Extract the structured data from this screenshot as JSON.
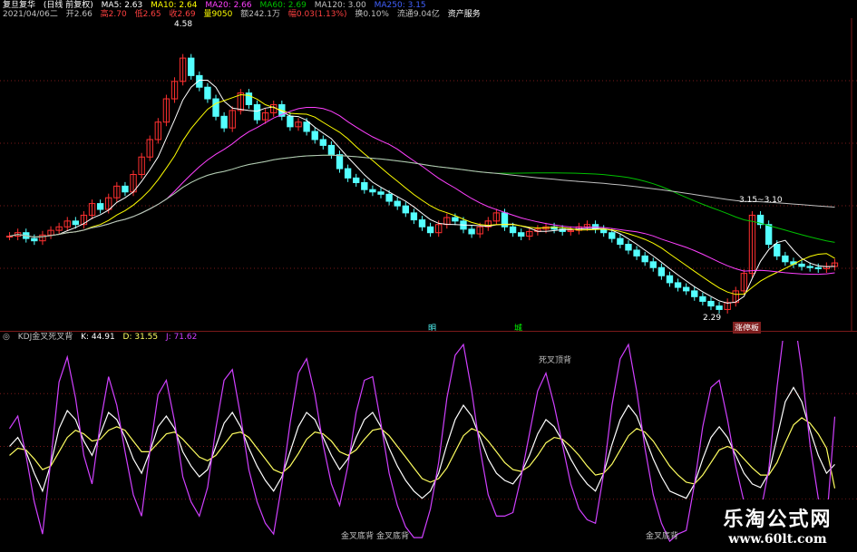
{
  "header": {
    "line1": {
      "stock": "复旦复华",
      "mode": "(日线 前复权)",
      "ma5": "MA5: 2.63",
      "ma10": "MA10: 2.64",
      "ma20": "MA20: 2.66",
      "ma60": "MA60: 2.69",
      "ma120": "MA120: 3.00",
      "ma250": "MA250: 3.15"
    },
    "line2": {
      "date": "2021/04/06二",
      "open": "开2.66",
      "high": "高2.70",
      "low": "低2.65",
      "close": "收2.69",
      "volume": "量9050",
      "amount": "额242.1万",
      "change": "幅0.03(1.13%)",
      "turnover": "换0.10%",
      "float": "流通9.04亿",
      "asset": "资产服务"
    }
  },
  "price_annotations": {
    "high_label": "4.58",
    "low_label": "2.29",
    "range_label": "3.15~3.10",
    "marker_a": "明",
    "marker_b": "城",
    "marker_c": "涨停板"
  },
  "kdj_header": {
    "title": "KDJ金叉死叉背",
    "k": "K: 44.91",
    "d": "D: 31.55",
    "j": "J: 71.62"
  },
  "kdj_annotations": {
    "death_divergence": "死叉顶背",
    "golden_div_1": "金叉底背",
    "golden_div_2": "金叉底背",
    "golden_div_3": "金叉底背"
  },
  "watermark": {
    "title": "乐淘公式网",
    "url": "www.60lt.com"
  },
  "colors": {
    "up": "#ff3030",
    "down": "#54ffff",
    "ma5": "#ffffff",
    "ma10": "#ffff00",
    "ma20": "#ff40ff",
    "ma60": "#00c000",
    "ma120": "#c0c0c0",
    "kdj_k": "#ffffff",
    "kdj_d": "#ffff60",
    "kdj_j": "#d040ff",
    "grid": "#7a1a1a"
  },
  "chart_data": [
    {
      "type": "candlestick",
      "title": "复旦复华 (日线 前复权)",
      "ylim": [
        2.2,
        4.7
      ],
      "high": 4.58,
      "low": 2.29,
      "close": [
        2.92,
        2.95,
        2.9,
        2.88,
        2.93,
        2.97,
        3.0,
        3.05,
        3.02,
        3.1,
        3.2,
        3.15,
        3.25,
        3.35,
        3.3,
        3.45,
        3.6,
        3.75,
        3.9,
        4.1,
        4.25,
        4.45,
        4.3,
        4.2,
        4.1,
        3.95,
        3.85,
        4.0,
        4.15,
        4.05,
        3.92,
        3.98,
        4.05,
        3.95,
        3.86,
        3.9,
        3.82,
        3.75,
        3.7,
        3.62,
        3.5,
        3.42,
        3.38,
        3.32,
        3.3,
        3.28,
        3.22,
        3.18,
        3.12,
        3.06,
        3.0,
        2.95,
        3.02,
        3.08,
        3.05,
        2.98,
        2.94,
        3.0,
        3.05,
        3.12,
        3.0,
        2.95,
        2.92,
        2.96,
        2.98,
        3.0,
        2.98,
        2.96,
        2.97,
        3.0,
        3.02,
        2.98,
        2.95,
        2.9,
        2.85,
        2.8,
        2.75,
        2.7,
        2.65,
        2.58,
        2.52,
        2.48,
        2.45,
        2.4,
        2.36,
        2.32,
        2.29,
        2.35,
        2.45,
        2.6,
        3.1,
        3.02,
        2.85,
        2.75,
        2.7,
        2.68,
        2.66,
        2.65,
        2.64,
        2.66,
        2.69
      ]
    },
    {
      "type": "line",
      "title": "KDJ金叉死叉背",
      "ylim": [
        0,
        110
      ],
      "series": [
        {
          "name": "K",
          "values": [
            55,
            60,
            52,
            40,
            30,
            45,
            65,
            75,
            70,
            58,
            50,
            62,
            74,
            70,
            60,
            48,
            40,
            52,
            66,
            72,
            65,
            52,
            44,
            38,
            42,
            55,
            68,
            74,
            66,
            54,
            44,
            36,
            30,
            38,
            52,
            66,
            74,
            70,
            60,
            50,
            42,
            48,
            60,
            70,
            74,
            66,
            54,
            44,
            36,
            30,
            26,
            30,
            40,
            56,
            70,
            78,
            72,
            60,
            48,
            40,
            36,
            34,
            40,
            50,
            62,
            70,
            66,
            58,
            48,
            40,
            34,
            30,
            40,
            56,
            70,
            78,
            72,
            60,
            48,
            38,
            30,
            28,
            26,
            34,
            48,
            60,
            66,
            60,
            50,
            40,
            34,
            32,
            40,
            60,
            80,
            88,
            80,
            64,
            50,
            40,
            44.91
          ]
        },
        {
          "name": "D",
          "values": [
            50,
            54,
            53,
            48,
            42,
            44,
            52,
            60,
            64,
            62,
            58,
            59,
            64,
            66,
            64,
            58,
            52,
            52,
            57,
            62,
            63,
            59,
            54,
            49,
            47,
            50,
            56,
            62,
            63,
            60,
            54,
            48,
            42,
            40,
            44,
            51,
            59,
            63,
            62,
            58,
            52,
            50,
            53,
            59,
            64,
            65,
            61,
            55,
            49,
            43,
            37,
            35,
            37,
            43,
            52,
            61,
            65,
            63,
            58,
            52,
            46,
            42,
            41,
            44,
            50,
            57,
            60,
            59,
            55,
            50,
            44,
            39,
            40,
            45,
            53,
            61,
            65,
            63,
            58,
            51,
            44,
            39,
            35,
            34,
            39,
            46,
            53,
            55,
            53,
            48,
            43,
            39,
            39,
            46,
            57,
            67,
            71,
            68,
            62,
            54,
            31.55
          ]
        },
        {
          "name": "J",
          "values": [
            65,
            72,
            50,
            24,
            6,
            47,
            91,
            105,
            82,
            50,
            34,
            68,
            94,
            78,
            52,
            28,
            16,
            52,
            84,
            92,
            69,
            38,
            24,
            16,
            32,
            65,
            92,
            98,
            72,
            42,
            24,
            12,
            6,
            34,
            68,
            96,
            104,
            84,
            56,
            34,
            22,
            44,
            74,
            92,
            94,
            68,
            40,
            22,
            10,
            4,
            4,
            20,
            46,
            82,
            106,
            112,
            86,
            54,
            28,
            16,
            16,
            18,
            38,
            62,
            86,
            96,
            78,
            56,
            34,
            20,
            14,
            12,
            40,
            78,
            104,
            112,
            86,
            54,
            28,
            12,
            2,
            6,
            8,
            34,
            66,
            88,
            92,
            70,
            44,
            24,
            16,
            18,
            42,
            88,
            126,
            130,
            98,
            56,
            26,
            12,
            71.62
          ]
        }
      ]
    }
  ]
}
